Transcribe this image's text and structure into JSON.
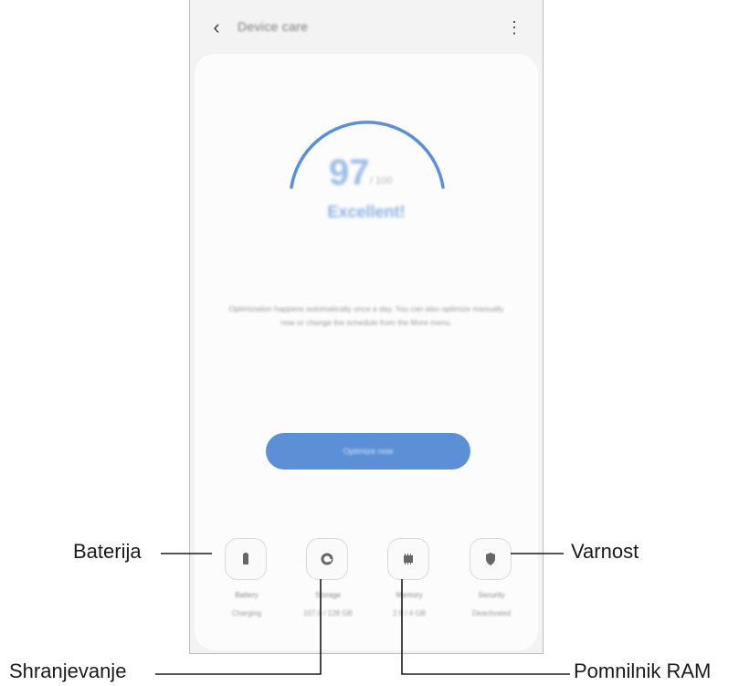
{
  "app": {
    "title": "Device care",
    "back_icon": "‹",
    "more_icon": "⋮"
  },
  "score": {
    "value": "97",
    "max": "/ 100",
    "status": "Excellent!",
    "gauge_fraction": 0.97
  },
  "description": "Optimization happens automatically once a day. You can also optimize manually now or change the schedule from the More menu.",
  "optimize_button": "Optimize now",
  "features": [
    {
      "name": "Battery",
      "sub": "Charging",
      "icon": "battery-icon"
    },
    {
      "name": "Storage",
      "sub": "107.0 / 128 GB",
      "icon": "storage-icon"
    },
    {
      "name": "Memory",
      "sub": "2.9 / 4 GB",
      "icon": "memory-icon"
    },
    {
      "name": "Security",
      "sub": "Deactivated",
      "icon": "security-icon"
    }
  ],
  "callouts": {
    "battery": "Baterija",
    "storage": "Shranjevanje",
    "memory": "Pomnilnik RAM",
    "security": "Varnost"
  },
  "colors": {
    "accent": "#5b8fd6",
    "gauge": "#5b8fd6"
  }
}
